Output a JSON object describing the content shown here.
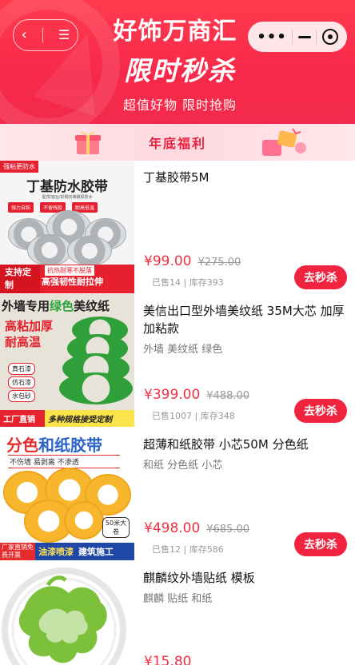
{
  "header": {
    "title": "好饰万商汇",
    "subtitle": "限时秒杀",
    "tagline": "超值好物 限时抢购",
    "back_icon": "chevron-left-icon",
    "menu_icon": "hamburger-icon",
    "capsule_more_icon": "more-dots-icon",
    "capsule_minimize_icon": "minimize-icon",
    "capsule_close_icon": "target-close-icon",
    "theme_color": "#f7294a"
  },
  "banner_strip": {
    "title": "年底福利"
  },
  "products": [
    {
      "name": "丁基胶带5M",
      "tags": "",
      "price": "¥99.00",
      "original_price": "¥275.00",
      "stock_info": "已售14 | 库存393",
      "button": "去秒杀",
      "image": {
        "corner": "强粘更防水",
        "headline": "丁基防水胶带",
        "small_text": "屋顶/窗台/彩钢瓦等破损防水",
        "chips": [
          "强力自粘",
          "不留残胶",
          "耐高低温"
        ],
        "bottom_left": "支持定制",
        "bottom_top": "抗热耐寒不脱落",
        "bottom_right": "高强韧性耐拉伸"
      }
    },
    {
      "name": "美信出口型外墙美纹纸 35M大芯 加厚加粘款",
      "tags": "外墙 美纹纸 绿色",
      "price": "¥399.00",
      "original_price": "¥488.00",
      "stock_info": "已售1007 | 库存348",
      "button": "去秒杀",
      "image": {
        "headline_a": "外墙专用",
        "headline_b": "绿色",
        "headline_c": "美纹纸",
        "feature_1": "高粘加厚",
        "feature_2": "耐高温",
        "labels": [
          "真石漆",
          "仿石漆",
          "水包砂"
        ],
        "bar_left": "工厂直销",
        "bar_right": "多种规格接受定制"
      }
    },
    {
      "name": "超薄和纸胶带 小芯50M 分色纸",
      "tags": "和纸 分色纸 小芯",
      "price": "¥498.00",
      "original_price": "¥685.00",
      "stock_info": "已售12 | 库存586",
      "button": "去秒杀",
      "image": {
        "headline_a": "分色",
        "headline_b": "和纸胶带",
        "sub": "不伤墙 易剥离 不渗透",
        "badge": "50米大卷",
        "bar_left": "厂家直销免费开票",
        "bar_mid": "油漆喷漆",
        "bar_right": "建筑施工"
      }
    },
    {
      "name": "麒麟纹外墙贴纸 模板",
      "tags": "麒麟 贴纸 和纸",
      "price": "¥15.80",
      "original_price": "",
      "stock_info": "",
      "button": ""
    }
  ]
}
